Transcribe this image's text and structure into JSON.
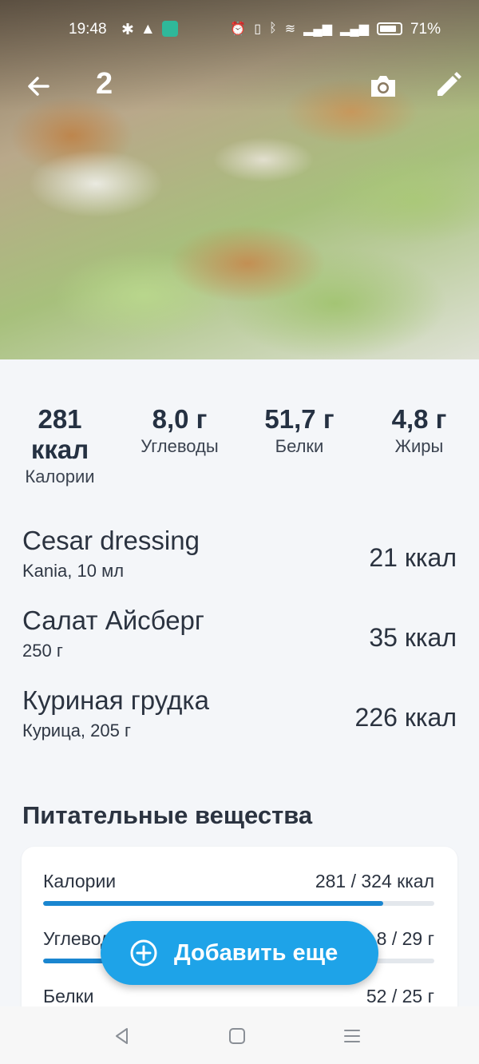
{
  "status_bar": {
    "time": "19:48",
    "battery": "71%"
  },
  "app_bar": {
    "photo_count": "2",
    "icons": [
      "arrow-left-icon",
      "camera-icon",
      "pencil-icon"
    ]
  },
  "summary": {
    "calories": {
      "value": "281",
      "unit": "ккал",
      "label": "Калории"
    },
    "carbs": {
      "value": "8,0 г",
      "label": "Углеводы"
    },
    "protein": {
      "value": "51,7 г",
      "label": "Белки"
    },
    "fat": {
      "value": "4,8 г",
      "label": "Жиры"
    }
  },
  "items": [
    {
      "name": "Cesar dressing",
      "detail": "Kania, 10 мл",
      "kcal": "21 ккал"
    },
    {
      "name": "Салат Айсберг",
      "detail": "250 г",
      "kcal": "35 ккал"
    },
    {
      "name": "Куриная грудка",
      "detail": "Курица, 205 г",
      "kcal": "226 ккал"
    }
  ],
  "nutrients": {
    "title": "Питательные вещества",
    "rows": [
      {
        "label": "Калории",
        "value": "281 / 324 ккал",
        "progress": 0.87,
        "color": "#1a86d0"
      },
      {
        "label": "Углеводы",
        "value": "8 / 29 г",
        "progress": 0.28,
        "color": "#1a86d0"
      },
      {
        "label": "Белки",
        "value": "52 / 25 г",
        "progress": 1.0,
        "color": "#1a86d0"
      }
    ]
  },
  "fab": {
    "label": "Добавить еще",
    "color": "#1ea3e8"
  }
}
